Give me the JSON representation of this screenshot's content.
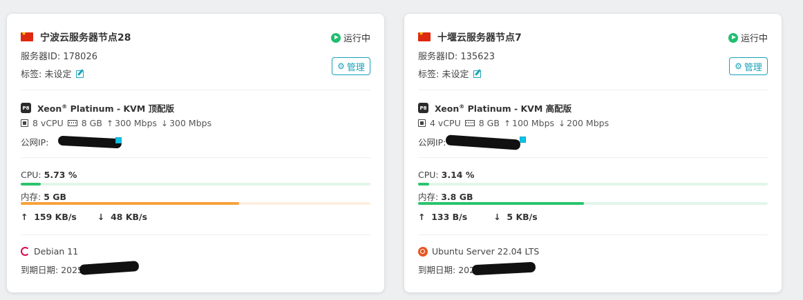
{
  "servers": [
    {
      "flag": "cn-flag-icon",
      "name": "宁波云服务器节点28",
      "status": "运行中",
      "server_id": "服务器ID: 178026",
      "tag_label": "标签: 未设定",
      "manage_label": "管理",
      "cpu_brand": "Xeon",
      "cpu_reg": "®",
      "cpu_model": " Platinum - KVM 顶配版",
      "vcpu": "8 vCPU",
      "ram": "8 GB",
      "up_bw": "300 Mbps",
      "down_bw": "300 Mbps",
      "ip_label": "公网IP:",
      "cpu_label": "CPU:",
      "cpu_value": "5.73 %",
      "cpu_fraction": 0.0573,
      "mem_label": "内存:",
      "mem_value": "5 GB",
      "mem_fraction": 0.625,
      "net_up": "159 KB/s",
      "net_down": "48 KB/s",
      "os_icon": "debian-icon",
      "os": "Debian 11",
      "expire_label": "到期日期:",
      "expire_visible": "2025"
    },
    {
      "flag": "cn-flag-icon",
      "name": "十堰云服务器节点7",
      "status": "运行中",
      "server_id": "服务器ID: 135623",
      "tag_label": "标签: 未设定",
      "manage_label": "管理",
      "cpu_brand": "Xeon",
      "cpu_reg": "®",
      "cpu_model": " Platinum - KVM 高配版",
      "vcpu": "4 vCPU",
      "ram": "8 GB",
      "up_bw": "100 Mbps",
      "down_bw": "200 Mbps",
      "ip_label": "公网IP:",
      "cpu_label": "CPU:",
      "cpu_value": "3.14 %",
      "cpu_fraction": 0.0314,
      "mem_label": "内存:",
      "mem_value": "3.8 GB",
      "mem_fraction": 0.475,
      "net_up": "133 B/s",
      "net_down": "5 KB/s",
      "os_icon": "ubuntu-icon",
      "os": "Ubuntu Server 22.04 LTS",
      "expire_label": "到期日期:",
      "expire_visible": "202"
    }
  ],
  "colors": {
    "accent": "#17a2b8",
    "running": "#1fbf70",
    "cpu_fill": "#2bc46e",
    "cpu_track": "#e2f5ea",
    "mem_fill_warning": "#f7a23b",
    "mem_track_warning": "#fdeee0",
    "mem_fill_ok": "#2bc46e",
    "mem_track_ok": "#e2f5ea"
  }
}
